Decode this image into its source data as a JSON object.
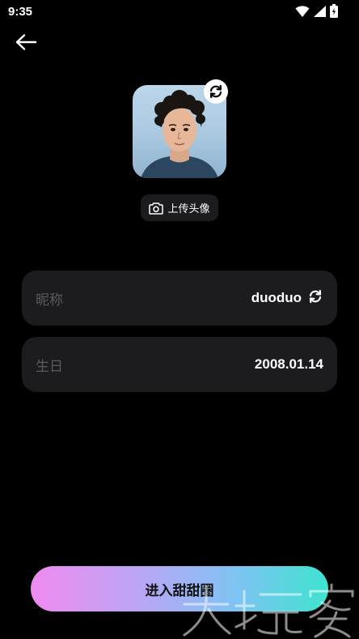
{
  "status_bar": {
    "time": "9:35",
    "icons": [
      "wifi-icon",
      "signal-icon",
      "battery-icon"
    ]
  },
  "header": {
    "back_icon": "arrow-left-icon"
  },
  "avatar": {
    "swap_icon": "refresh-icon",
    "upload_label": "上传头像",
    "upload_icon": "camera-icon"
  },
  "form": {
    "nickname": {
      "label": "昵称",
      "value": "duoduo",
      "icon": "refresh-icon"
    },
    "birthday": {
      "label": "生日",
      "value": "2008.01.14"
    }
  },
  "enter_button": {
    "label": "进入甜甜圈",
    "gradient": [
      "#f08af0",
      "#b8a6f5",
      "#7cc4f2",
      "#3ee3cf"
    ]
  },
  "colors": {
    "background": "#000000",
    "card": "#1c1c1e",
    "label": "#5a5a5e"
  }
}
